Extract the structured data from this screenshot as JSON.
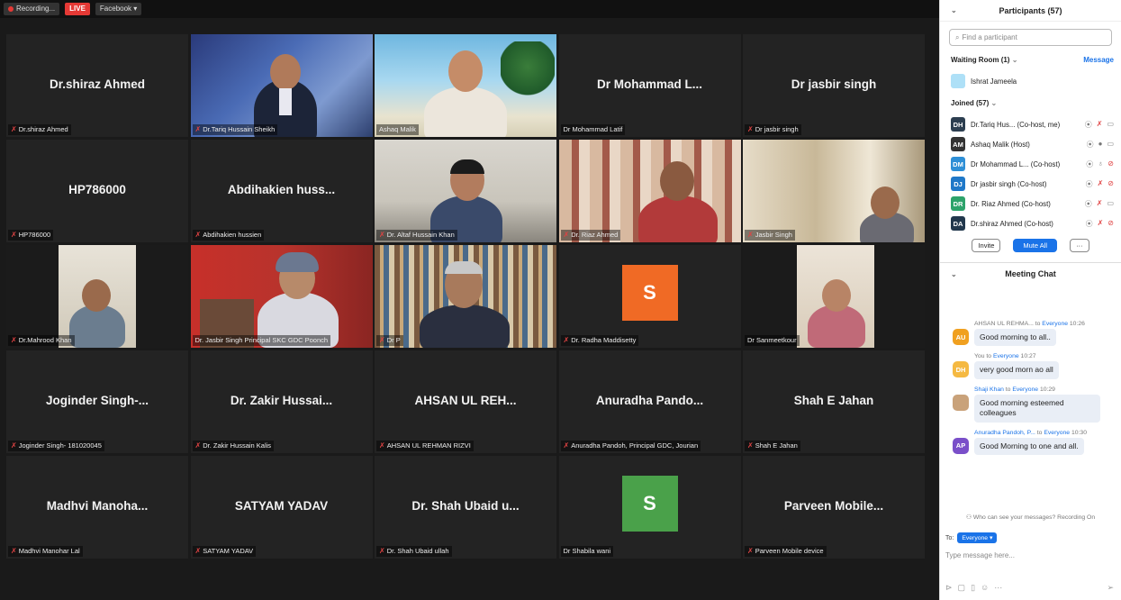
{
  "topbar": {
    "recording": "Recording...",
    "live": "LIVE",
    "facebook": "Facebook ▾"
  },
  "tiles": [
    {
      "name": "Dr.shiraz Ahmed",
      "label": "Dr.shiraz Ahmed",
      "muted": true
    },
    {
      "name": "",
      "label": "Dr.Tariq Hussain Sheikh",
      "muted": true
    },
    {
      "name": "",
      "label": "Ashaq Malik",
      "muted": false
    },
    {
      "name": "Dr Mohammad L...",
      "label": "Dr Mohammad Latif",
      "muted": false
    },
    {
      "name": "Dr jasbir singh",
      "label": "Dr jasbir singh",
      "muted": true
    },
    {
      "name": "HP786000",
      "label": "HP786000",
      "muted": true
    },
    {
      "name": "Abdihakien huss...",
      "label": "Abdihakien hussien",
      "muted": true
    },
    {
      "name": "",
      "label": "Dr. Altaf Hussain Khan",
      "muted": true
    },
    {
      "name": "",
      "label": "Dr. Riaz Ahmed",
      "muted": true
    },
    {
      "name": "",
      "label": "Jasbir Singh",
      "muted": true
    },
    {
      "name": "",
      "label": "Dr.Mahrood Khan",
      "muted": true
    },
    {
      "name": "",
      "label": "Dr. Jasbir Singh Principal SKC GDC Poonch",
      "muted": false
    },
    {
      "name": "",
      "label": "Dr P",
      "muted": true
    },
    {
      "name": "",
      "label": "Dr. Radha Maddisetty",
      "muted": true
    },
    {
      "name": "",
      "label": "Dr Sanmeetkour",
      "muted": false
    },
    {
      "name": "Joginder Singh-...",
      "label": "Joginder Singh- 181020045",
      "muted": true
    },
    {
      "name": "Dr. Zakir Hussai...",
      "label": "Dr. Zakir Hussain Kalis",
      "muted": true
    },
    {
      "name": "AHSAN UL REH...",
      "label": "AHSAN UL REHMAN RIZVI",
      "muted": true
    },
    {
      "name": "Anuradha Pando...",
      "label": "Anuradha Pandoh, Principal GDC, Jourian",
      "muted": true
    },
    {
      "name": "Shah E Jahan",
      "label": "Shah E Jahan",
      "muted": true
    },
    {
      "name": "Madhvi Manoha...",
      "label": "Madhvi Manohar Lal",
      "muted": true
    },
    {
      "name": "SATYAM YADAV",
      "label": "SATYAM YADAV",
      "muted": true
    },
    {
      "name": "Dr. Shah Ubaid u...",
      "label": "Dr. Shah Ubaid ullah",
      "muted": true
    },
    {
      "name": "",
      "label": "Dr Shabila wani",
      "muted": false
    },
    {
      "name": "Parveen Mobile...",
      "label": "Parveen Mobile device",
      "muted": true
    }
  ],
  "avatars": {
    "radha": "S",
    "shabila": "S",
    "radha_color": "#f06a25",
    "shabila_color": "#4aa14a"
  },
  "participants": {
    "title": "Participants (57)",
    "search_placeholder": "Find a participant",
    "waiting_room": "Waiting Room (1)",
    "message": "Message",
    "waiting_name": "Ishrat Jameela",
    "joined": "Joined (57)",
    "list": [
      {
        "initials": "DH",
        "name": "Dr.Tariq Hus... (Co-host, me)",
        "color": "#2c3e50"
      },
      {
        "initials": "AM",
        "name": "Ashaq Malik (Host)",
        "color": "#333333"
      },
      {
        "initials": "DM",
        "name": "Dr Mohammad L... (Co-host)",
        "color": "#2e8fd6"
      },
      {
        "initials": "DJ",
        "name": "Dr jasbir singh (Co-host)",
        "color": "#1f78c8"
      },
      {
        "initials": "DR",
        "name": "Dr. Riaz Ahmed (Co-host)",
        "color": "#2da36b"
      },
      {
        "initials": "DA",
        "name": "Dr.shiraz Ahmed (Co-host)",
        "color": "#22384d"
      }
    ],
    "invite": "Invite",
    "mute_all": "Mute All",
    "more": "···"
  },
  "chat": {
    "title": "Meeting Chat",
    "messages": [
      {
        "initials": "AU",
        "color": "#f0a020",
        "sender": "AHSAN UL REHMA...",
        "to": "to",
        "target": "Everyone",
        "time": "10:26",
        "text": "Good morning to all.."
      },
      {
        "initials": "DH",
        "color": "#f5b942",
        "sender": "You",
        "to": "to",
        "target": "Everyone",
        "time": "10:27",
        "text": "very good morn ao all"
      },
      {
        "initials": "",
        "color": "#c9a27a",
        "sender": "Shaji Khan",
        "to": "to",
        "target": "Everyone",
        "time": "10:29",
        "text": "Good morning esteemed colleagues"
      },
      {
        "initials": "AP",
        "color": "#7a4fc9",
        "sender": "Anuradha Pandoh, P...",
        "to": "to",
        "target": "Everyone",
        "time": "10:30",
        "text": "Good Morning to one and all."
      }
    ],
    "who_can_see": "Who can see your messages? Recording On",
    "to_label": "To:",
    "to_value": "Everyone ▾",
    "type_placeholder": "Type message here..."
  }
}
